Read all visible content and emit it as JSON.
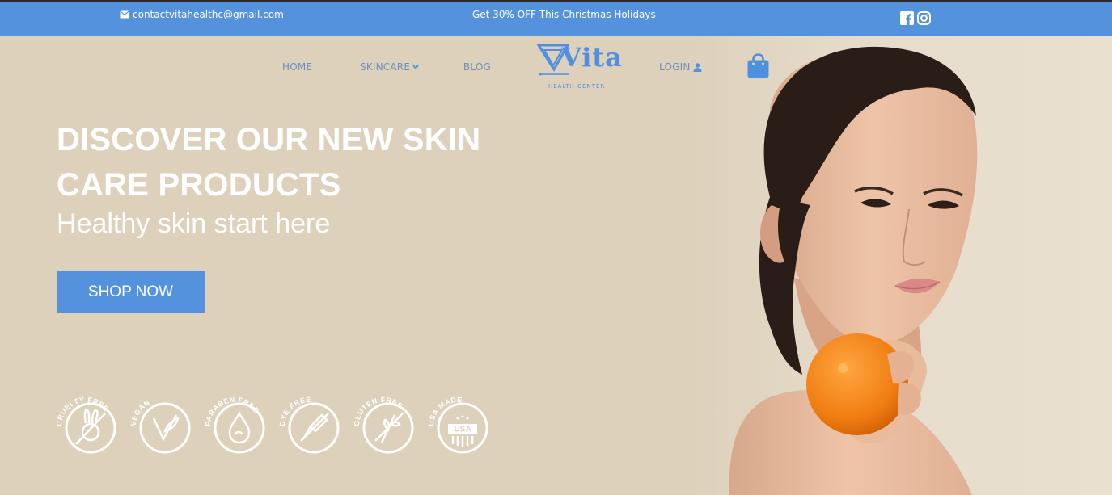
{
  "topbar": {
    "email": "contactvitahealthc@gmail.com",
    "promo": "Get 30% OFF This Christmas Holidays",
    "social": [
      "facebook-icon",
      "instagram-icon"
    ]
  },
  "nav": {
    "home": "HOME",
    "skincare": "SKINCARE",
    "blog": "BLOG",
    "login": "LOGIN",
    "logo": {
      "word": "Vita",
      "sub": "HEALTH CENTER"
    }
  },
  "hero": {
    "headline_line1": "DISCOVER OUR NEW SKIN",
    "headline_line2": "CARE PRODUCTS",
    "subhead": "Healthy skin start here",
    "cta": "SHOP NOW"
  },
  "badges": [
    {
      "label": "CRUELTY FREE",
      "icon": "bunny-icon"
    },
    {
      "label": "VEGAN",
      "icon": "leaf-v-icon"
    },
    {
      "label": "PARABEN FREE",
      "icon": "droplet-icon"
    },
    {
      "label": "DYE FREE",
      "icon": "dropper-icon"
    },
    {
      "label": "GLUTEN FREE",
      "icon": "wheat-icon"
    },
    {
      "label": "USA MADE",
      "icon": "usa-seal-icon"
    }
  ],
  "colors": {
    "primary_blue": "#5592de",
    "hero_bg": "#ddd1bb",
    "nav_text": "#6f8fbd",
    "white": "#ffffff"
  }
}
